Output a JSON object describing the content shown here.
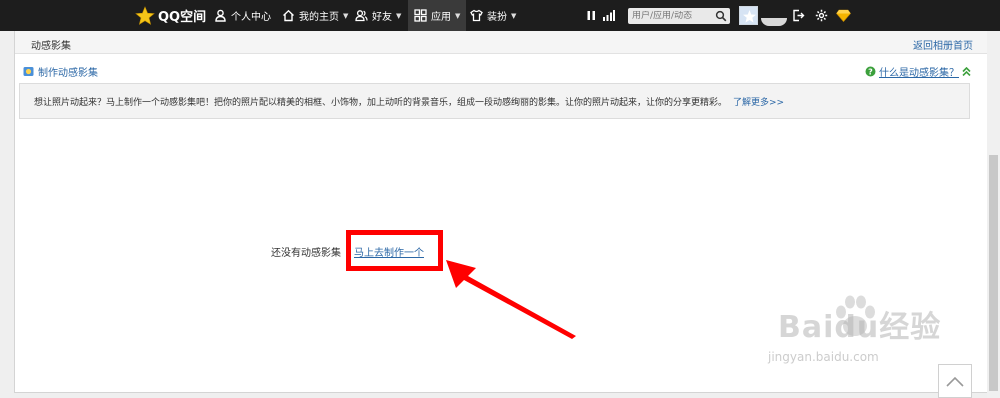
{
  "nav": {
    "logo": "QQ空间",
    "items": [
      {
        "label": "个人中心",
        "icon": "person-icon"
      },
      {
        "label": "我的主页",
        "icon": "home-icon"
      },
      {
        "label": "好友",
        "icon": "friends-icon"
      },
      {
        "label": "应用",
        "icon": "apps-icon"
      },
      {
        "label": "装扮",
        "icon": "shirt-icon"
      }
    ],
    "search_placeholder": "用户/应用/动态"
  },
  "panel": {
    "title": "动感影集",
    "back_link": "返回相册首页",
    "make_label": "制作动感影集",
    "what_link": "什么是动感影集？",
    "info_text": "想让照片动起来？马上制作一个动感影集吧！把你的照片配以精美的相框、小饰物，加上动听的背景音乐，组成一段动感绚丽的影集。让你的照片动起来，让你的分享更精彩。",
    "learn_more": "了解更多>>",
    "empty_text": "还没有动感影集",
    "make_now_link": "马上去制作一个"
  },
  "watermark": {
    "brand": "Baidu经验",
    "url": "jingyan.baidu.com"
  },
  "colors": {
    "topbar": "#1d1d1d",
    "link": "#2b67a6",
    "highlight": "#ff0000",
    "background": "#efefef"
  }
}
